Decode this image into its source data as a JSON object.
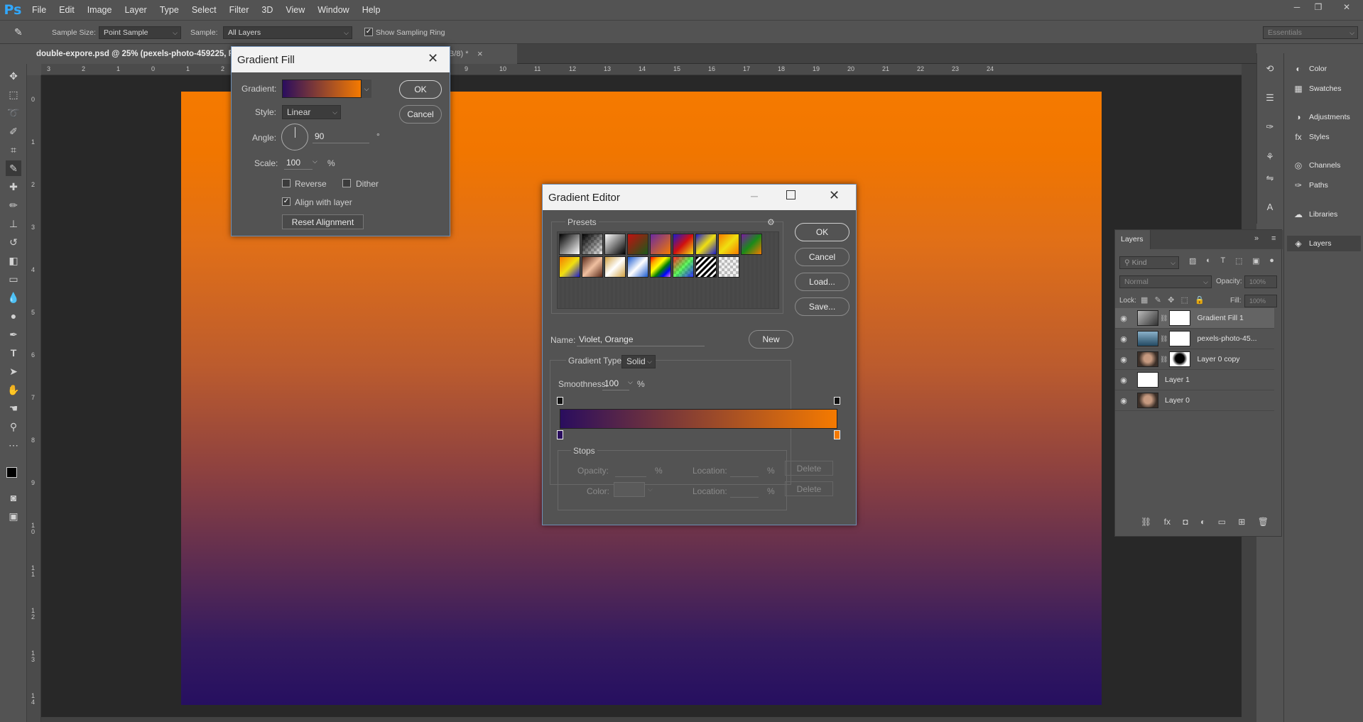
{
  "app": {
    "logo": "Ps",
    "menu": [
      "File",
      "Edit",
      "Image",
      "Layer",
      "Type",
      "Select",
      "Filter",
      "3D",
      "View",
      "Window",
      "Help"
    ],
    "window_controls": [
      "─",
      "❐",
      "✕"
    ]
  },
  "options": {
    "sample_size_label": "Sample Size:",
    "sample_size_value": "Point Sample",
    "sample_label": "Sample:",
    "sample_value": "All Layers",
    "ring_label": "Show Sampling Ring",
    "ring_checked": "✓",
    "workspace": "Essentials"
  },
  "document": {
    "tab_title": "double-expore.psd @ 25% (pexels-photo-459225, RGB/8)",
    "tab_title_shown": "double-expore.psd @ 25% (pexels-photo-459225, RG",
    "tab_suffix": "B/8) *",
    "close": "×",
    "ruler_h": [
      "3",
      "2",
      "1",
      "0",
      "1",
      "2",
      "3",
      "4",
      "5",
      "6",
      "7",
      "8",
      "9",
      "10",
      "11",
      "12",
      "13",
      "14",
      "15",
      "16",
      "17",
      "18",
      "19",
      "20",
      "21",
      "22",
      "23",
      "24"
    ],
    "ruler_v": [
      "0",
      "1",
      "2",
      "3",
      "4",
      "5",
      "6",
      "7",
      "8",
      "9",
      "1 0",
      "1 1",
      "1 2",
      "1 3",
      "1 4"
    ]
  },
  "gradient_fill": {
    "title": "Gradient Fill",
    "gradient_label": "Gradient:",
    "style_label": "Style:",
    "style_value": "Linear",
    "angle_label": "Angle:",
    "angle_value": "90",
    "degree": "°",
    "scale_label": "Scale:",
    "scale_value": "100",
    "scale_unit": "%",
    "reverse_label": "Reverse",
    "dither_label": "Dither",
    "align_label": "Align with layer",
    "align_checked": "✓",
    "reset_label": "Reset Alignment",
    "ok": "OK",
    "cancel": "Cancel",
    "colors": {
      "start": "#2a0d5e",
      "end": "#f57a00"
    }
  },
  "gradient_editor": {
    "title": "Gradient Editor",
    "presets_label": "Presets",
    "name_label": "Name:",
    "name_value": "Violet, Orange",
    "new": "New",
    "ok": "OK",
    "cancel": "Cancel",
    "load": "Load...",
    "save": "Save...",
    "type_label": "Gradient Type:",
    "type_value": "Solid",
    "smooth_label": "Smoothness:",
    "smooth_value": "100",
    "smooth_unit": "%",
    "stops_label": "Stops",
    "opacity_label": "Opacity:",
    "opacity_unit": "%",
    "location_label": "Location:",
    "location_unit": "%",
    "delete": "Delete",
    "color_label": "Color:"
  },
  "dock": {
    "items": [
      "Color",
      "Swatches",
      "Adjustments",
      "Styles",
      "Channels",
      "Paths",
      "Libraries",
      "Layers"
    ]
  },
  "layers_panel": {
    "tab": "Layers",
    "kind_placeholder": "Kind",
    "blend_mode": "Normal",
    "opacity_label": "Opacity:",
    "opacity_value": "100%",
    "lock_label": "Lock:",
    "fill_label": "Fill:",
    "fill_value": "100%",
    "layers": [
      "Gradient Fill 1",
      "pexels-photo-45...",
      "Layer 0 copy",
      "Layer 1",
      "Layer 0"
    ]
  }
}
